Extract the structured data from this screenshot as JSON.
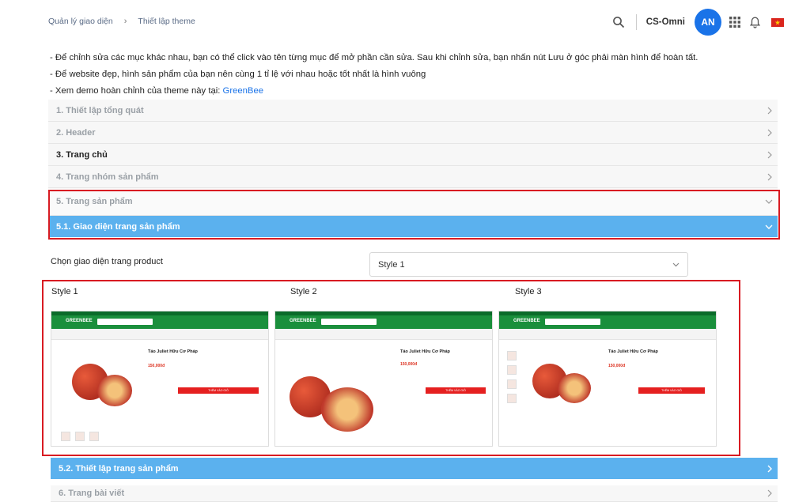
{
  "breadcrumb": {
    "item1": "Quản lý giao diện",
    "sep": "›",
    "item2": "Thiết lập theme"
  },
  "topbar": {
    "brand": "CS-Omni",
    "avatar": "AN",
    "icons": [
      "search-icon",
      "apps-grid-icon",
      "bell-icon",
      "vietnam-flag-icon"
    ]
  },
  "info": [
    "- Để chỉnh sửa các mục khác nhau, bạn có thể click vào tên từng mục để mở phần cần sửa. Sau khi chỉnh sửa, bạn nhấn nút Lưu ở góc phải màn hình để hoàn tất.",
    "- Để website đẹp, hình sản phẩm của bạn nên cùng 1 tỉ lệ với nhau hoặc tốt nhất là hình vuông",
    "- Xem demo hoàn chỉnh của theme này tại: "
  ],
  "demo_link": "GreenBee",
  "sections": [
    {
      "label": "1. Thiết lập tổng quát"
    },
    {
      "label": "2. Header"
    },
    {
      "label": "3. Trang chủ"
    },
    {
      "label": "4. Trang nhóm sản phẩm"
    },
    {
      "label": "5. Trang sản phẩm"
    },
    {
      "label": "5.1. Giao diện trang sản phẩm"
    }
  ],
  "chooser": {
    "label": "Chọn giao diện trang product",
    "value": "Style 1"
  },
  "styles": [
    {
      "label": "Style 1",
      "shop": "GREENBEE",
      "product": "Táo Juliet Hữu Cơ Pháp",
      "price": "150,000đ",
      "btn": "THÊM VÀO GIỎ"
    },
    {
      "label": "Style 2",
      "shop": "GREENBEE",
      "product": "Táo Juliet Hữu Cơ Pháp",
      "price": "150,000đ",
      "btn": "THÊM VÀO GIỎ"
    },
    {
      "label": "Style 3",
      "shop": "GREENBEE",
      "product": "Táo Juliet Hữu Cơ Pháp",
      "price": "150,000đ",
      "btn": "THÊM VÀO GIỎ"
    }
  ],
  "bottom_sections": [
    {
      "label": "5.2. Thiết lập trang sản phẩm"
    },
    {
      "label": "6. Trang bài viết"
    }
  ],
  "colors": {
    "accent": "#1a73e8",
    "section_blue": "#5bb1ee",
    "highlight": "#d81b22",
    "theme_green": "#1a8f3c"
  }
}
